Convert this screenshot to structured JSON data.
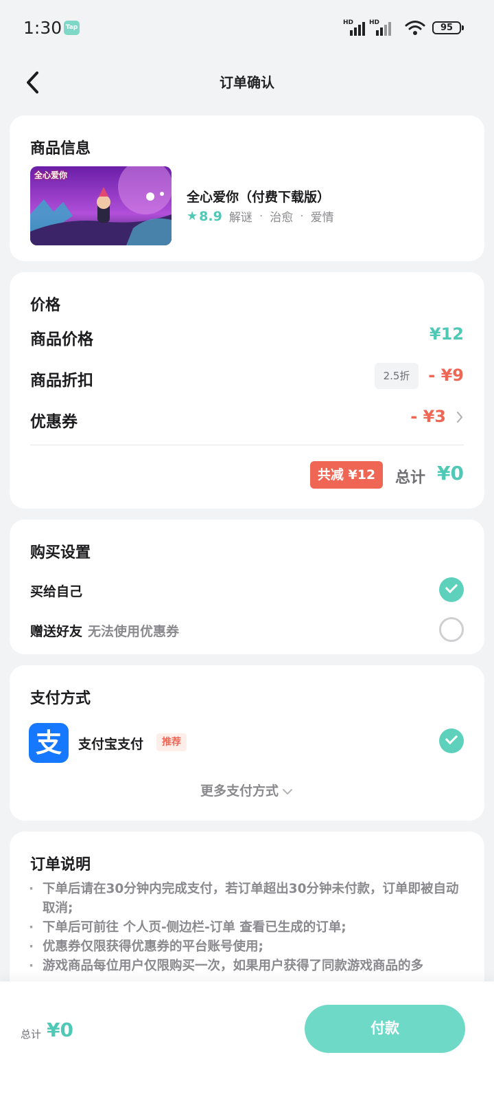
{
  "status_bar": {
    "time": "1:30",
    "app_badge": "Tap",
    "signal_label_1": "HD",
    "signal_label_2": "HD",
    "battery": "95"
  },
  "header": {
    "title": "订单确认"
  },
  "product": {
    "section_title": "商品信息",
    "thumb_logo_text": "全心爱你",
    "name": "全心爱你（付费下载版）",
    "rating": "8.9",
    "tags": [
      "解谜",
      "治愈",
      "爱情"
    ]
  },
  "price": {
    "section_title": "价格",
    "item_price_label": "商品价格",
    "item_price_value": "¥12",
    "discount_label": "商品折扣",
    "discount_tag": "2.5折",
    "discount_value": "- ¥9",
    "coupon_label": "优惠券",
    "coupon_value": "- ¥3",
    "savings_badge": "共减 ¥12",
    "total_label": "总计",
    "total_value": "¥0"
  },
  "purchase_settings": {
    "section_title": "购买设置",
    "option_self": "买给自己",
    "option_gift": "赠送好友",
    "option_gift_note": "无法使用优惠券",
    "selected": "self"
  },
  "payment": {
    "section_title": "支付方式",
    "method_icon_char": "支",
    "method_name": "支付宝支付",
    "recommend_tag": "推荐",
    "more_methods": "更多支付方式"
  },
  "order_notes": {
    "section_title": "订单说明",
    "items": [
      "下单后请在30分钟内完成支付，若订单超出30分钟未付款，订单即被自动取消;",
      "下单后可前往 个人页-侧边栏-订单 查看已生成的订单;",
      "优惠券仅限获得优惠券的平台账号使用;",
      "游戏商品每位用户仅限购买一次，如果用户获得了同款游戏商品的多"
    ]
  },
  "bottom_bar": {
    "total_label": "总计",
    "total_value": "¥0",
    "pay_button": "付款"
  },
  "colors": {
    "accent": "#4fc9b5",
    "discount_red": "#ef6655",
    "alipay_blue": "#1677ff",
    "background": "#f2f3f5"
  }
}
